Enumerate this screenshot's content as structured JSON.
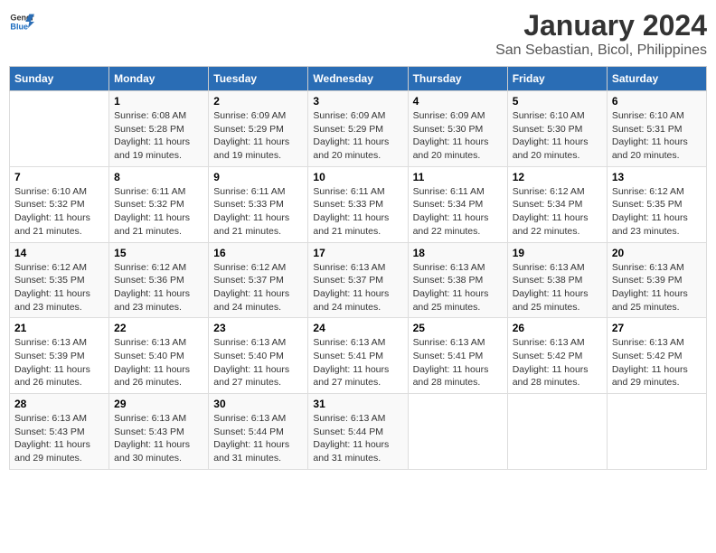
{
  "header": {
    "logo_line1": "General",
    "logo_line2": "Blue",
    "title": "January 2024",
    "subtitle": "San Sebastian, Bicol, Philippines"
  },
  "days_of_week": [
    "Sunday",
    "Monday",
    "Tuesday",
    "Wednesday",
    "Thursday",
    "Friday",
    "Saturday"
  ],
  "weeks": [
    [
      {
        "day": "",
        "info": ""
      },
      {
        "day": "1",
        "info": "Sunrise: 6:08 AM\nSunset: 5:28 PM\nDaylight: 11 hours\nand 19 minutes."
      },
      {
        "day": "2",
        "info": "Sunrise: 6:09 AM\nSunset: 5:29 PM\nDaylight: 11 hours\nand 19 minutes."
      },
      {
        "day": "3",
        "info": "Sunrise: 6:09 AM\nSunset: 5:29 PM\nDaylight: 11 hours\nand 20 minutes."
      },
      {
        "day": "4",
        "info": "Sunrise: 6:09 AM\nSunset: 5:30 PM\nDaylight: 11 hours\nand 20 minutes."
      },
      {
        "day": "5",
        "info": "Sunrise: 6:10 AM\nSunset: 5:30 PM\nDaylight: 11 hours\nand 20 minutes."
      },
      {
        "day": "6",
        "info": "Sunrise: 6:10 AM\nSunset: 5:31 PM\nDaylight: 11 hours\nand 20 minutes."
      }
    ],
    [
      {
        "day": "7",
        "info": "Sunrise: 6:10 AM\nSunset: 5:32 PM\nDaylight: 11 hours\nand 21 minutes."
      },
      {
        "day": "8",
        "info": "Sunrise: 6:11 AM\nSunset: 5:32 PM\nDaylight: 11 hours\nand 21 minutes."
      },
      {
        "day": "9",
        "info": "Sunrise: 6:11 AM\nSunset: 5:33 PM\nDaylight: 11 hours\nand 21 minutes."
      },
      {
        "day": "10",
        "info": "Sunrise: 6:11 AM\nSunset: 5:33 PM\nDaylight: 11 hours\nand 21 minutes."
      },
      {
        "day": "11",
        "info": "Sunrise: 6:11 AM\nSunset: 5:34 PM\nDaylight: 11 hours\nand 22 minutes."
      },
      {
        "day": "12",
        "info": "Sunrise: 6:12 AM\nSunset: 5:34 PM\nDaylight: 11 hours\nand 22 minutes."
      },
      {
        "day": "13",
        "info": "Sunrise: 6:12 AM\nSunset: 5:35 PM\nDaylight: 11 hours\nand 23 minutes."
      }
    ],
    [
      {
        "day": "14",
        "info": "Sunrise: 6:12 AM\nSunset: 5:35 PM\nDaylight: 11 hours\nand 23 minutes."
      },
      {
        "day": "15",
        "info": "Sunrise: 6:12 AM\nSunset: 5:36 PM\nDaylight: 11 hours\nand 23 minutes."
      },
      {
        "day": "16",
        "info": "Sunrise: 6:12 AM\nSunset: 5:37 PM\nDaylight: 11 hours\nand 24 minutes."
      },
      {
        "day": "17",
        "info": "Sunrise: 6:13 AM\nSunset: 5:37 PM\nDaylight: 11 hours\nand 24 minutes."
      },
      {
        "day": "18",
        "info": "Sunrise: 6:13 AM\nSunset: 5:38 PM\nDaylight: 11 hours\nand 25 minutes."
      },
      {
        "day": "19",
        "info": "Sunrise: 6:13 AM\nSunset: 5:38 PM\nDaylight: 11 hours\nand 25 minutes."
      },
      {
        "day": "20",
        "info": "Sunrise: 6:13 AM\nSunset: 5:39 PM\nDaylight: 11 hours\nand 25 minutes."
      }
    ],
    [
      {
        "day": "21",
        "info": "Sunrise: 6:13 AM\nSunset: 5:39 PM\nDaylight: 11 hours\nand 26 minutes."
      },
      {
        "day": "22",
        "info": "Sunrise: 6:13 AM\nSunset: 5:40 PM\nDaylight: 11 hours\nand 26 minutes."
      },
      {
        "day": "23",
        "info": "Sunrise: 6:13 AM\nSunset: 5:40 PM\nDaylight: 11 hours\nand 27 minutes."
      },
      {
        "day": "24",
        "info": "Sunrise: 6:13 AM\nSunset: 5:41 PM\nDaylight: 11 hours\nand 27 minutes."
      },
      {
        "day": "25",
        "info": "Sunrise: 6:13 AM\nSunset: 5:41 PM\nDaylight: 11 hours\nand 28 minutes."
      },
      {
        "day": "26",
        "info": "Sunrise: 6:13 AM\nSunset: 5:42 PM\nDaylight: 11 hours\nand 28 minutes."
      },
      {
        "day": "27",
        "info": "Sunrise: 6:13 AM\nSunset: 5:42 PM\nDaylight: 11 hours\nand 29 minutes."
      }
    ],
    [
      {
        "day": "28",
        "info": "Sunrise: 6:13 AM\nSunset: 5:43 PM\nDaylight: 11 hours\nand 29 minutes."
      },
      {
        "day": "29",
        "info": "Sunrise: 6:13 AM\nSunset: 5:43 PM\nDaylight: 11 hours\nand 30 minutes."
      },
      {
        "day": "30",
        "info": "Sunrise: 6:13 AM\nSunset: 5:44 PM\nDaylight: 11 hours\nand 31 minutes."
      },
      {
        "day": "31",
        "info": "Sunrise: 6:13 AM\nSunset: 5:44 PM\nDaylight: 11 hours\nand 31 minutes."
      },
      {
        "day": "",
        "info": ""
      },
      {
        "day": "",
        "info": ""
      },
      {
        "day": "",
        "info": ""
      }
    ]
  ]
}
